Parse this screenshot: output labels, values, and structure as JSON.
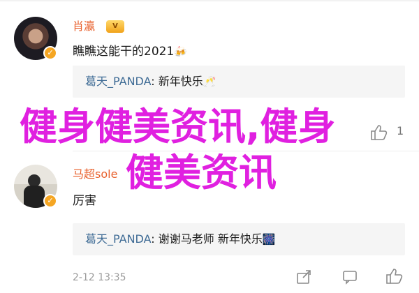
{
  "comments": [
    {
      "username": "肖瀛",
      "vip_label": "V",
      "verified_mark": "✓",
      "text": "瞧瞧这能干的2021",
      "emoji": "🍻",
      "reply": {
        "name": "葛天_PANDA",
        "separator": ":",
        "text": "新年快乐",
        "emoji": "🥂"
      },
      "like_count": "1"
    },
    {
      "username": "马超sole",
      "verified_mark": "✓",
      "text": "厉害",
      "reply": {
        "name": "葛天_PANDA",
        "separator": ":",
        "text": "谢谢马老师 新年快乐",
        "emoji": "🎆"
      },
      "time": "2-12 13:35"
    }
  ],
  "overlay": {
    "line1": "健身健美资讯,健身",
    "line2": "健美资讯"
  },
  "icons": {
    "like": "thumbs-up-icon",
    "comment": "comment-icon",
    "share": "share-icon",
    "vip": "vip-badge-icon",
    "verified": "verified-check-icon"
  },
  "colors": {
    "username": "#e8602c",
    "reply_name": "#3e6b95",
    "overlay": "#e020e0",
    "verified": "#f5a623"
  }
}
